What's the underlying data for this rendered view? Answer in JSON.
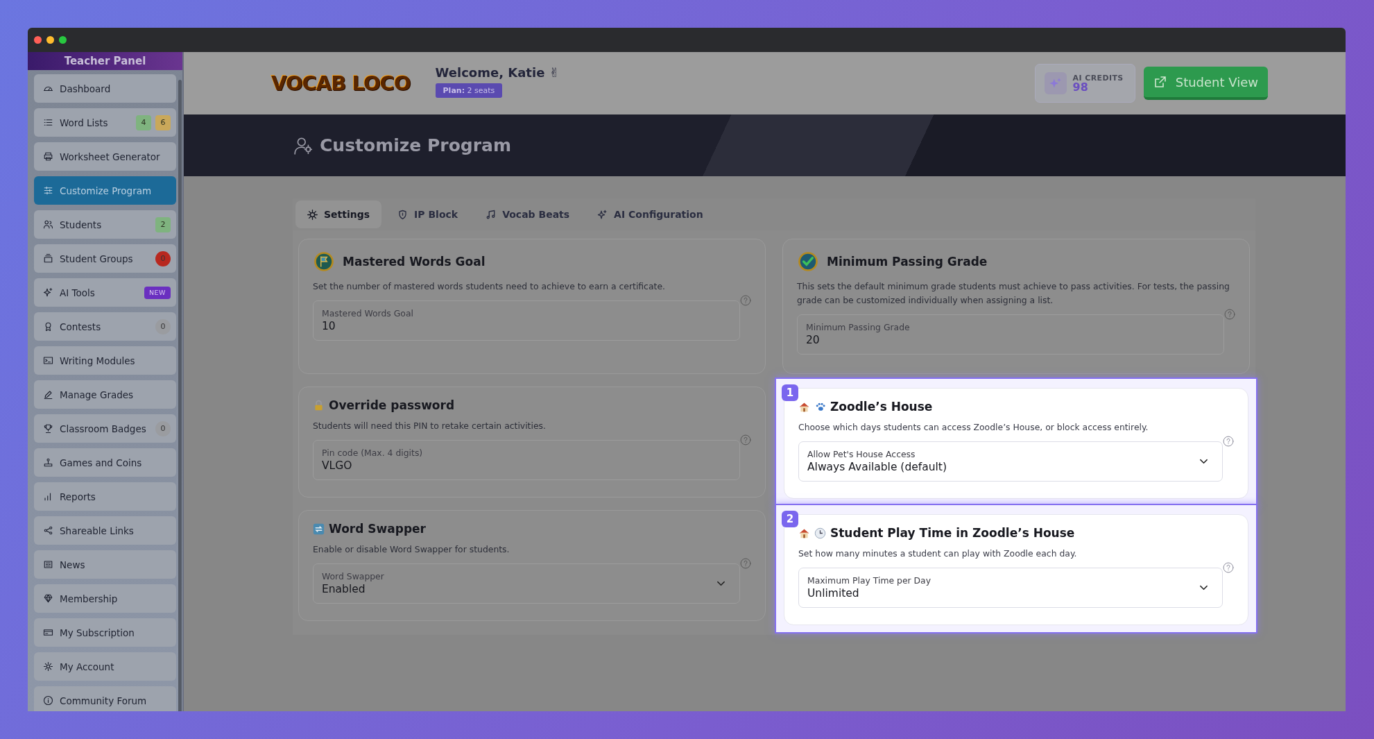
{
  "sidebar": {
    "title": "Teacher Panel",
    "items": [
      {
        "label": "Dashboard",
        "selected": false
      },
      {
        "label": "Word Lists",
        "selected": false,
        "badges": [
          {
            "text": "4",
            "color": "#7fb37f"
          },
          {
            "text": "6",
            "color": "#c9a85a"
          }
        ]
      },
      {
        "label": "Worksheet Generator",
        "selected": false
      },
      {
        "label": "Customize Program",
        "selected": true
      },
      {
        "label": "Students",
        "selected": false,
        "badges": [
          {
            "text": "2",
            "color": "#7fb37f"
          }
        ]
      },
      {
        "label": "Student Groups",
        "selected": false,
        "badges": [
          {
            "text": "0",
            "color": "#b8281f",
            "kind": "dot"
          }
        ]
      },
      {
        "label": "AI Tools",
        "selected": false,
        "badges": [
          {
            "text": "NEW",
            "color": "#6a2fc0",
            "kind": "tag"
          }
        ]
      },
      {
        "label": "Contests",
        "selected": false,
        "badges": [
          {
            "text": "0",
            "color": "#9a9ca0",
            "kind": "dot"
          }
        ]
      },
      {
        "label": "Writing Modules",
        "selected": false
      },
      {
        "label": "Manage Grades",
        "selected": false
      },
      {
        "label": "Classroom Badges",
        "selected": false,
        "badges": [
          {
            "text": "0",
            "color": "#9a9ca0",
            "kind": "dot"
          }
        ]
      },
      {
        "label": "Games and Coins",
        "selected": false
      },
      {
        "label": "Reports",
        "selected": false
      },
      {
        "label": "Shareable Links",
        "selected": false
      },
      {
        "label": "News",
        "selected": false
      },
      {
        "label": "Membership",
        "selected": false
      },
      {
        "label": "My Subscription",
        "selected": false
      },
      {
        "label": "My Account",
        "selected": false
      },
      {
        "label": "Community Forum",
        "selected": false
      }
    ]
  },
  "header": {
    "logo": "VOCAB LOCO",
    "welcome": "Welcome, Katie ✌",
    "plan": "**Plan:** 2 seats",
    "credits_label": "AI CREDITS",
    "credits": "98",
    "student_view": "Student View"
  },
  "banner": {
    "title": "Customize Program"
  },
  "tabs": [
    {
      "label": "Settings",
      "selected": true
    },
    {
      "label": "IP Block",
      "selected": false
    },
    {
      "label": "Vocab Beats",
      "selected": false
    },
    {
      "label": "AI Configuration",
      "selected": false
    }
  ],
  "columns": [
    [
      {
        "title": "Mastered Words Goal",
        "description": "Set the number of mastered words students need to achieve to earn a certificate.",
        "field": {
          "kind": "input",
          "label": "Mastered Words Goal",
          "value": "10"
        },
        "highlighted": false
      },
      {
        "title": "Override password",
        "description": "Students will need this PIN to retake certain activities.",
        "field": {
          "kind": "input",
          "label": "Pin code (Max. 4 digits)",
          "value": "VLGO"
        },
        "highlighted": false
      },
      {
        "title": "Word Swapper",
        "description": "Enable or disable Word Swapper for students.",
        "field": {
          "kind": "select",
          "label": "Word Swapper",
          "value": "Enabled"
        },
        "highlighted": false
      }
    ],
    [
      {
        "title": "Minimum Passing Grade",
        "description": "This sets the default minimum grade students must achieve to pass activities. For tests, the passing grade can be customized individually when assigning a list.",
        "field": {
          "kind": "input",
          "label": "Minimum Passing Grade",
          "value": "20"
        },
        "highlighted": false
      },
      {
        "title": "Zoodle’s House",
        "description": "Choose which days students can access Zoodle’s House, or block access entirely.",
        "field": {
          "kind": "select",
          "label": "Allow Pet's House Access",
          "value": "Always Available (default)"
        },
        "highlighted": true,
        "step": "1"
      },
      {
        "title": "Student Play Time in Zoodle’s House",
        "description": "Set how many minutes a student can play with Zoodle each day.",
        "field": {
          "kind": "select",
          "label": "Maximum Play Time per Day",
          "value": "Unlimited"
        },
        "highlighted": true,
        "step": "2"
      }
    ]
  ]
}
